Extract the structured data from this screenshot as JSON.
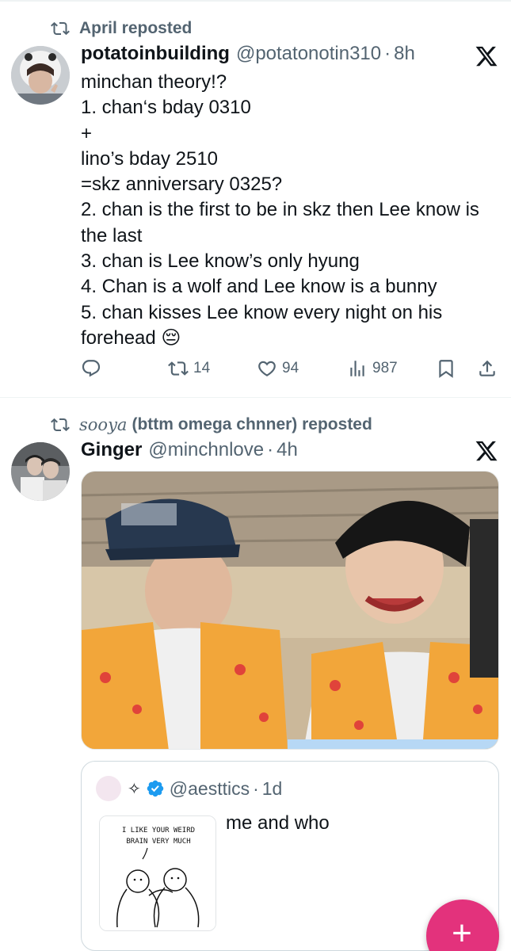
{
  "tweets": [
    {
      "repost_by": "April reposted",
      "display_name": "potatoinbuilding",
      "handle": "@potatonotin310",
      "dot": "·",
      "time": "8h",
      "lines": [
        "minchan theory!?",
        "1. chan‘s bday 0310",
        "+",
        "lino’s bday 2510",
        "=skz anniversary 0325?",
        "2. chan is the first to be in skz then Lee know is the last",
        "3. chan is Lee know’s only hyung",
        "4. Chan is a wolf and Lee know is a bunny",
        "5. chan kisses Lee know every night on his forehead 😔"
      ],
      "actions": {
        "reply_count": "",
        "repost_count": "14",
        "like_count": "94",
        "view_count": "987"
      }
    },
    {
      "repost_by_name": "sooya",
      "repost_by_rest": "(bttm omega chnner) reposted",
      "display_name": "Ginger",
      "handle": "@minchnlove",
      "dot": "·",
      "time": "4h",
      "quote": {
        "sparkle": "✧",
        "handle": "@aesttics",
        "dot": "·",
        "time": "1d",
        "text": "me and who",
        "comic_text_line1": "I LIKE YOUR WEIRD",
        "comic_text_line2": "BRAIN VERY MUCH"
      }
    }
  ],
  "fab": {
    "label": "+",
    "color": "#e3327c"
  },
  "colors": {
    "text": "#0f1419",
    "muted": "#536471",
    "verified": "#1d9bf0",
    "divider": "#eff3f4"
  },
  "icons": [
    "repost-icon",
    "x-logo-icon",
    "reply-icon",
    "like-icon",
    "views-icon",
    "bookmark-icon",
    "share-icon",
    "verified-icon",
    "sparkle-icon",
    "compose-icon"
  ]
}
